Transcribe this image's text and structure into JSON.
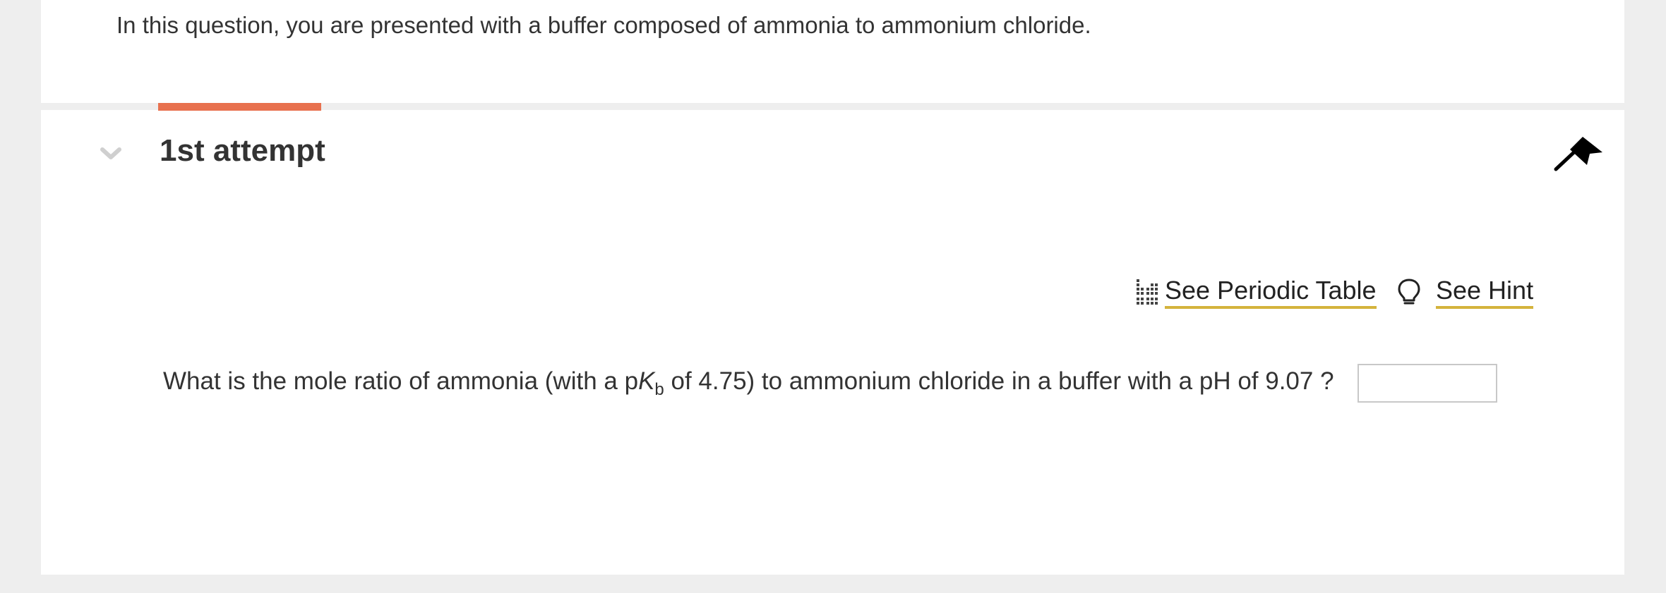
{
  "intro": {
    "text": "In this question, you are presented with a buffer composed of ammonia to ammonium chloride."
  },
  "attempt": {
    "title": "1st attempt",
    "accent_color": "#e8714f"
  },
  "tools": {
    "periodic_table_label": "See Periodic Table",
    "hint_label": "See Hint",
    "underline_color": "#d4b33c"
  },
  "question": {
    "prefix": "What is the mole ratio of ammonia (with a p",
    "k_symbol": "K",
    "k_subscript": "b",
    "suffix": " of 4.75) to ammonium chloride in a buffer with a pH of 9.07 ?",
    "answer_value": ""
  },
  "icons": {
    "collapse": "chevron-down-icon",
    "flag": "flag-icon",
    "periodic_table": "periodic-table-icon",
    "hint": "lightbulb-icon"
  }
}
